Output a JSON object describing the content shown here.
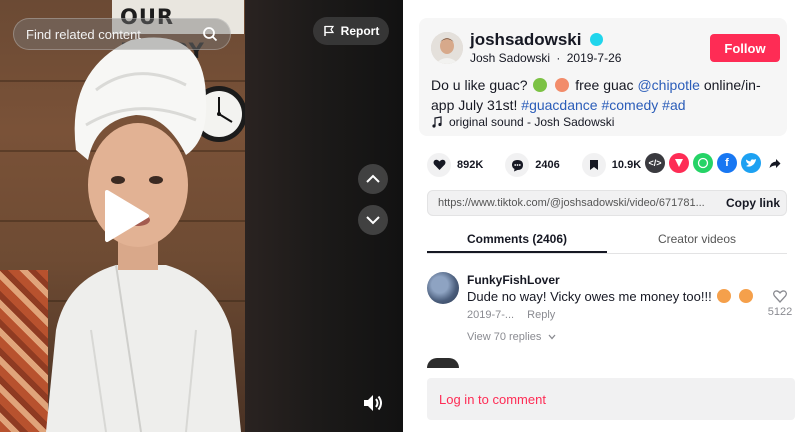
{
  "search": {
    "placeholder": "Find related content"
  },
  "video": {
    "sign_text": "OUR HAPPY",
    "report_label": "Report"
  },
  "author": {
    "username": "joshsadowski",
    "display_name": "Josh Sadowski",
    "date": "2019-7-26",
    "follow_label": "Follow",
    "verified_color": "#20d5ec"
  },
  "description": {
    "text_1": "Do u like guac?",
    "text_2": " free guac ",
    "mention": "@chipotle",
    "text_3": " online/in-app July 31st! ",
    "tag_1": "#guacdance",
    "tag_2": "#comedy",
    "tag_3": "#ad"
  },
  "music": {
    "label": "original sound - Josh Sadowski"
  },
  "stats": {
    "likes": "892K",
    "comments": "2406",
    "saves": "10.9K"
  },
  "share_icons": [
    "embed-icon",
    "share-red-icon",
    "whatsapp-icon",
    "facebook-icon",
    "twitter-icon",
    "forward-icon"
  ],
  "link": {
    "url": "https://www.tiktok.com/@joshsadowski/video/671781...",
    "copy_label": "Copy link"
  },
  "tabs": [
    {
      "label": "Comments (2406)"
    },
    {
      "label": "Creator videos"
    }
  ],
  "comment": {
    "user": "FunkyFishLover",
    "text": "Dude no way! Vicky owes me money too!!!",
    "date": "2019-7-...",
    "reply_label": "Reply",
    "likes": "5122",
    "view_replies": "View 70 replies"
  },
  "login": {
    "label": "Log in to comment"
  },
  "colors": {
    "accent": "#fe2c55",
    "link": "#2b5db9"
  }
}
